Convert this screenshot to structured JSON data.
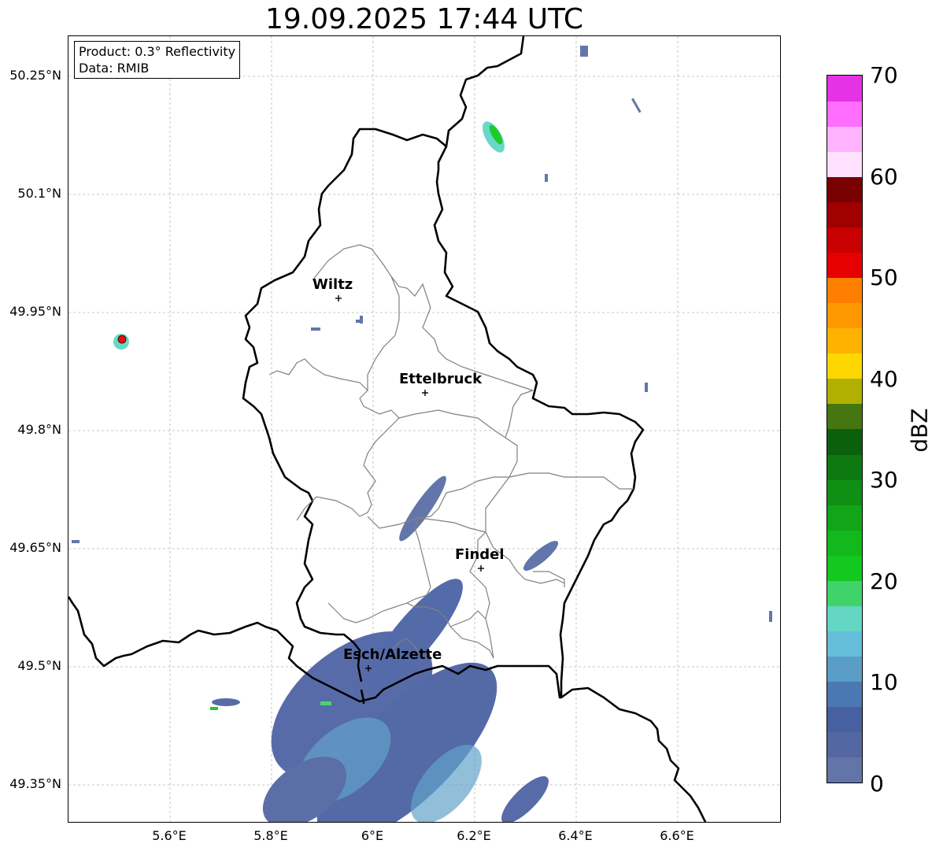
{
  "title": "19.09.2025 17:44 UTC",
  "info": {
    "product": "Product: 0.3° Reflectivity",
    "data": "Data: RMIB"
  },
  "lat_labels": [
    "50.25°N",
    "50.1°N",
    "49.95°N",
    "49.8°N",
    "49.65°N",
    "49.5°N",
    "49.35°N"
  ],
  "lon_labels": [
    "5.6°E",
    "5.8°E",
    "6°E",
    "6.2°E",
    "6.4°E",
    "6.6°E"
  ],
  "cities": [
    {
      "name": "Wiltz"
    },
    {
      "name": "Ettelbruck"
    },
    {
      "name": "Findel"
    },
    {
      "name": "Esch/Alzette"
    }
  ],
  "colorbar": {
    "label": "dBZ",
    "ticks": [
      "70",
      "60",
      "50",
      "40",
      "30",
      "20",
      "10",
      "0"
    ],
    "colors": [
      "#6374a8",
      "#5368a2",
      "#4660a0",
      "#4b78b3",
      "#5a9ec8",
      "#65bfda",
      "#63d6c4",
      "#3fd36a",
      "#13c81e",
      "#12b81c",
      "#12a518",
      "#0f8f14",
      "#0c7a10",
      "#0a600c",
      "#467612",
      "#b0b000",
      "#ffd700",
      "#ffb300",
      "#ff9800",
      "#ff7f00",
      "#e60000",
      "#c80000",
      "#a00000",
      "#780000",
      "#ffe0ff",
      "#ffb3ff",
      "#ff6eff",
      "#e632e6"
    ]
  },
  "colors": {
    "border": "#000000",
    "canton": "#808080",
    "grid": "#b8b8b8"
  }
}
